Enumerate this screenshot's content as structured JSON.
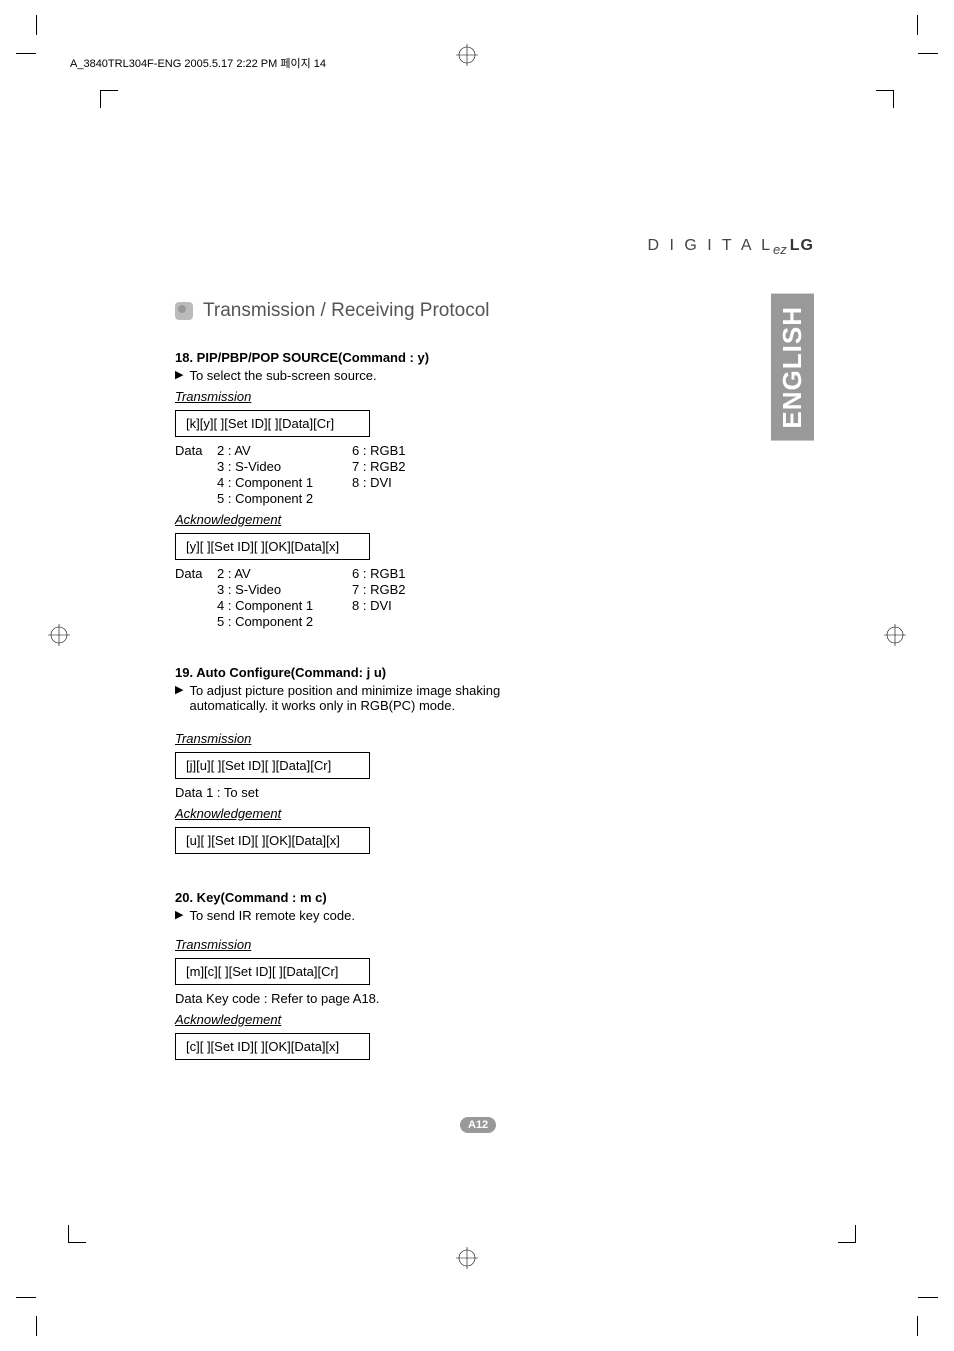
{
  "print_header": "A_3840TRL304F-ENG  2005.5.17  2:22 PM  페이지 14",
  "brand": {
    "digital": "D I G I T A L",
    "ez": "ez",
    "lg": "LG"
  },
  "language_tab": "ENGLISH",
  "section_title": "Transmission / Receiving Protocol",
  "labels": {
    "transmission": "Transmission",
    "acknowledgement": "Acknowledgement",
    "data": "Data"
  },
  "commands": [
    {
      "title": "18. PIP/PBP/POP SOURCE(Command : y)",
      "desc": "To select the sub-screen source.",
      "transmission_code": "[k][y][ ][Set ID][ ][Data][Cr]",
      "trans_data": [
        {
          "left": "2 : AV",
          "right": "6 : RGB1"
        },
        {
          "left": "3 : S-Video",
          "right": "7 : RGB2"
        },
        {
          "left": "4 : Component 1",
          "right": "8 : DVI"
        },
        {
          "left": "5 : Component 2",
          "right": ""
        }
      ],
      "ack_code": "[y][ ][Set ID][ ][OK][Data][x]",
      "ack_data": [
        {
          "left": "2 : AV",
          "right": "6 : RGB1"
        },
        {
          "left": "3 : S-Video",
          "right": "7 : RGB2"
        },
        {
          "left": "4 : Component 1",
          "right": "8 : DVI"
        },
        {
          "left": "5 : Component 2",
          "right": ""
        }
      ]
    },
    {
      "title": "19. Auto Configure(Command: j u)",
      "desc": "To adjust picture position and minimize image shaking automatically. it works only in RGB(PC) mode.",
      "transmission_code": "[j][u][ ][Set ID][ ][Data][Cr]",
      "trans_single": "Data 1 : To set",
      "ack_code": "[u][ ][Set ID][ ][OK][Data][x]"
    },
    {
      "title": "20. Key(Command : m c)",
      "desc": "To send IR remote key code.",
      "transmission_code": "[m][c][ ][Set ID][ ][Data][Cr]",
      "trans_single": "Data  Key code : Refer to page A18.",
      "ack_code": "[c][ ][Set ID][ ][OK][Data][x]"
    }
  ],
  "page_number": "A12"
}
